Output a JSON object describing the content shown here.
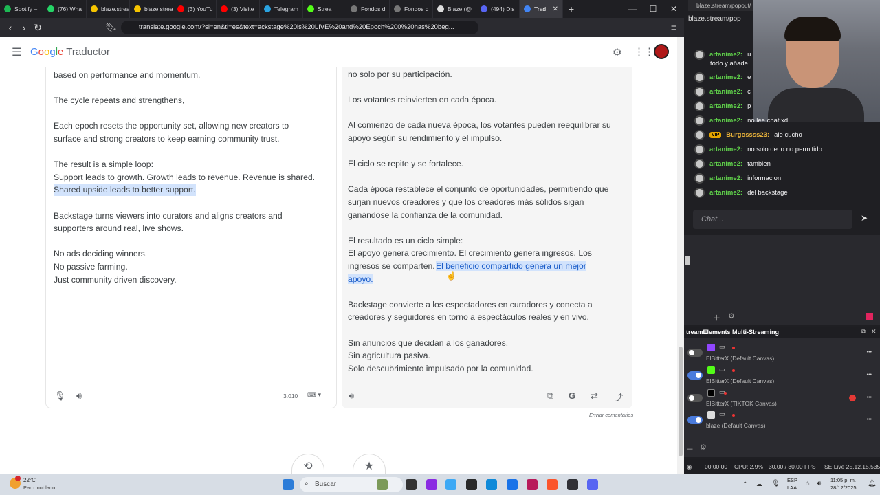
{
  "browser": {
    "tabs": [
      {
        "label": "Spotify –",
        "color": "#1db954"
      },
      {
        "label": "(76) Wha",
        "color": "#25d366"
      },
      {
        "label": "blaze.strea",
        "color": "#f5c400"
      },
      {
        "label": "blaze.strea",
        "color": "#f5c400"
      },
      {
        "label": "(3) YouTu",
        "color": "#ff0000"
      },
      {
        "label": "(3) Visite",
        "color": "#ff0000"
      },
      {
        "label": "Telegram",
        "color": "#2aa3e0"
      },
      {
        "label": "Strea",
        "color": "#53fc18"
      },
      {
        "label": "Fondos d",
        "color": "#777777"
      },
      {
        "label": "Fondos d",
        "color": "#777777"
      },
      {
        "label": "Blaze (@",
        "color": "#dddddd"
      },
      {
        "label": "(494) Dis",
        "color": "#5865f2"
      },
      {
        "label": "Trad",
        "color": "#4285f4"
      }
    ],
    "new_tab": "+",
    "url": "translate.google.com/?sl=en&tl=es&text=ackstage%20is%20LIVE%20and%20Epoch%200%20has%20beg..."
  },
  "translate": {
    "app_name": "Traductor",
    "logo": [
      "G",
      "o",
      "o",
      "g",
      "l",
      "e"
    ],
    "source_lines": [
      "based on performance and momentum.",
      "",
      "The cycle repeats and strengthens,",
      "",
      "Each epoch resets the opportunity set, allowing new creators to",
      "surface and strong creators to keep earning community trust.",
      "",
      "The result is a simple loop:",
      "Support leads to growth. Growth leads to revenue. Revenue is shared.",
      "Shared upside leads to better support.",
      "",
      "Backstage turns viewers into curators and aligns creators and",
      "supporters around real, live shows.",
      "",
      "No ads deciding winners.",
      "No passive farming.",
      "Just community driven discovery."
    ],
    "target_lines": [
      "no solo por su participación.",
      "",
      "Los votantes reinvierten en cada época.",
      "",
      "Al comienzo de cada nueva época, los votantes pueden reequilibrar su",
      "apoyo según su rendimiento y el impulso.",
      "",
      "El ciclo se repite y se fortalece.",
      "",
      "Cada época restablece el conjunto de oportunidades, permitiendo que",
      "surjan nuevos creadores y que los creadores más sólidos sigan",
      "ganándose la confianza de la comunidad.",
      "",
      "El resultado es un ciclo simple:",
      "El apoyo genera crecimiento. El crecimiento genera ingresos. Los",
      "ingresos se comparten.",
      "",
      "",
      "Backstage convierte a los espectadores en curadores y conecta a",
      "creadores y seguidores en torno a espectáculos reales y en vivo.",
      "",
      "Sin anuncios que decidan a los ganadores.",
      "Sin agricultura pasiva.",
      "Solo descubrimiento impulsado por la comunidad."
    ],
    "target_highlight_a": "El beneficio compartido genera un mejor",
    "target_highlight_b": "apoyo.",
    "char_count": "3.010",
    "feedback": "Enviar comentarios"
  },
  "side": {
    "popout_tab": "blaze.stream/popout/",
    "popout_url": "blaze.stream/pop",
    "chat": [
      {
        "user": "artanime2:",
        "text": "u",
        "extra": "todo y añade"
      },
      {
        "user": "artanime2:",
        "text": "e"
      },
      {
        "user": "artanime2:",
        "text": "c"
      },
      {
        "user": "artanime2:",
        "text": "p"
      },
      {
        "user": "artanime2:",
        "text": "no lee chat xd"
      },
      {
        "user": "Burgossss23:",
        "text": "ale cucho",
        "badge": "VIP"
      },
      {
        "user": "artanime2:",
        "text": "no solo de lo no permitido"
      },
      {
        "user": "artanime2:",
        "text": "tambien"
      },
      {
        "user": "artanime2:",
        "text": "informacion"
      },
      {
        "user": "artanime2:",
        "text": "del backstage"
      }
    ],
    "chat_placeholder": "Chat...",
    "se_title": "treamElements Multi-Streaming",
    "outputs": [
      {
        "label": "ElBitterX (Default Canvas)",
        "on": false,
        "color": "#9146ff"
      },
      {
        "label": "ElBitterX (Default Canvas)",
        "on": true,
        "color": "#53fc18"
      },
      {
        "label": "ElBitterX (TIKTOK Canvas)",
        "on": false,
        "color": "#000000"
      },
      {
        "label": "blaze (Default Canvas)",
        "on": true,
        "color": "#dddddd"
      }
    ],
    "status": {
      "time": "00:00:00",
      "cpu": "CPU: 2.9%",
      "fps": "30.00 / 30.00 FPS",
      "version": "SE.Live 25.12.15.535"
    }
  },
  "taskbar": {
    "weather_temp": "22°C",
    "weather_desc": "Parc. nublado",
    "search": "Buscar",
    "lang1": "ESP",
    "lang2": "LAA",
    "time": "11:05 p. m.",
    "date": "28/12/2025"
  }
}
